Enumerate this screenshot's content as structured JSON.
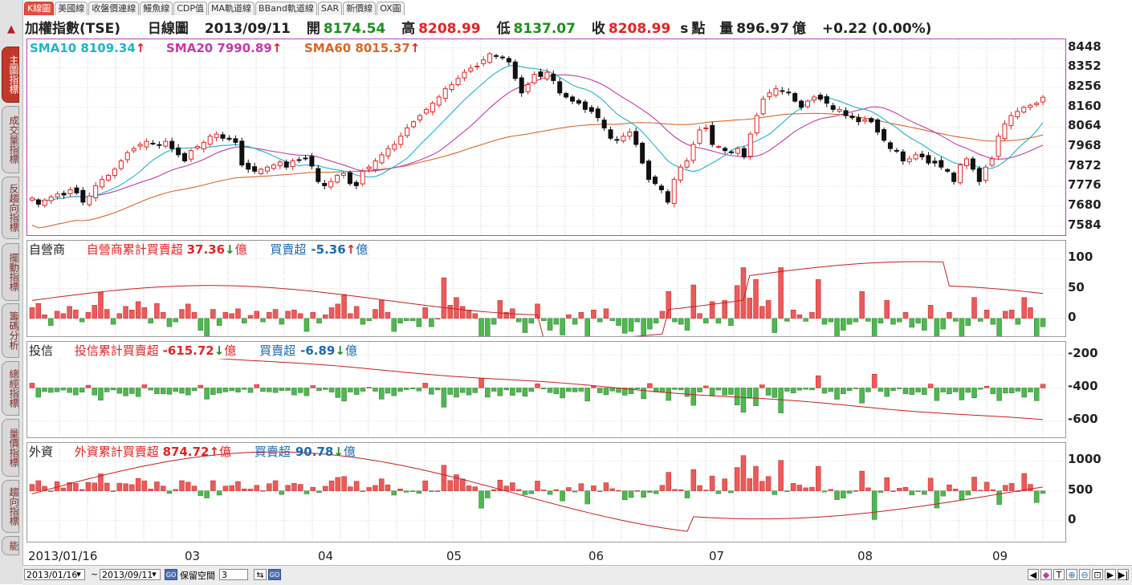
{
  "tabs": [
    "K線圖",
    "美國線",
    "收盤價連線",
    "鰻魚線",
    "CDP值",
    "MA軌道線",
    "BBand軌道線",
    "SAR",
    "新價線",
    "OX圖"
  ],
  "active_tab": 0,
  "side_tabs": [
    "主圖指標",
    "成交量指標",
    "反趨向指標",
    "擺動指標",
    "籌碼分析",
    "總經指標",
    "量價指標",
    "趨向指標",
    "能"
  ],
  "header": {
    "name": "加權指數(TSE)",
    "chart_type": "日線圖",
    "date": "2013/09/11",
    "open_label": "開",
    "open": "8174.54",
    "high_label": "高",
    "high": "8208.99",
    "low_label": "低",
    "low": "8137.07",
    "close_label": "收",
    "close": "8208.99",
    "s_label": "s",
    "points_label": "點",
    "vol_label": "量",
    "volume": "896.97",
    "vol_unit": "億",
    "change": "+0.22 (0.00%)"
  },
  "main": {
    "sma10": "SMA10 8109.34",
    "sma20": "SMA20 7990.89",
    "sma60": "SMA60 8015.37",
    "arrow_up": "↑",
    "yticks": [
      "8448",
      "8352",
      "8256",
      "8160",
      "8064",
      "7968",
      "7872",
      "7776",
      "7680",
      "7584"
    ]
  },
  "dealer": {
    "title": "自營商",
    "cum_label": "自營商累計買賣超",
    "cum": "37.36",
    "cum_arrow": "↓",
    "unit": "億",
    "net_label": "買賣超",
    "net": "-5.36",
    "net_arrow": "↑",
    "yticks": [
      "100",
      "50",
      "0"
    ]
  },
  "trust": {
    "title": "投信",
    "cum_label": "投信累計買賣超",
    "cum": "-615.72",
    "cum_arrow": "↓",
    "unit": "億",
    "net_label": "買賣超",
    "net": "-6.89",
    "net_arrow": "↓",
    "yticks": [
      "-200",
      "-400",
      "-600"
    ]
  },
  "foreign": {
    "title": "外資",
    "cum_label": "外資累計買賣超",
    "cum": "874.72",
    "cum_arrow": "↑",
    "unit": "億",
    "net_label": "買賣超",
    "net": "90.78",
    "net_arrow": "↓",
    "yticks": [
      "1000",
      "500",
      "0"
    ]
  },
  "date_axis": [
    "2013/01/16",
    "03",
    "04",
    "05",
    "06",
    "07",
    "08",
    "09"
  ],
  "bottom": {
    "from": "2013/01/16",
    "tilde": "~",
    "to": "2013/09/11",
    "keep": "保留空間",
    "keep_val": "3"
  },
  "colors": {
    "up": "#e52323",
    "down": "#1e8f1e",
    "sma10": "#1fb5c8",
    "sma20": "#c23aa8",
    "sma60": "#d8682a",
    "bar_up": "#ec5a5a",
    "bar_down": "#4fb84f"
  },
  "chart_data": {
    "type": "candlestick",
    "ylim": [
      7540,
      8490
    ],
    "close": [
      7720,
      7690,
      7710,
      7725,
      7740,
      7735,
      7760,
      7745,
      7700,
      7730,
      7780,
      7810,
      7830,
      7860,
      7900,
      7940,
      7960,
      7980,
      7995,
      7985,
      7975,
      7995,
      7960,
      7930,
      7900,
      7950,
      7970,
      7990,
      8020,
      8030,
      8010,
      8005,
      7990,
      7880,
      7860,
      7850,
      7860,
      7870,
      7880,
      7895,
      7870,
      7900,
      7905,
      7910,
      7875,
      7800,
      7780,
      7800,
      7830,
      7840,
      7790,
      7780,
      7850,
      7870,
      7900,
      7930,
      7960,
      7980,
      8020,
      8060,
      8090,
      8120,
      8150,
      8180,
      8210,
      8250,
      8270,
      8300,
      8330,
      8350,
      8360,
      8390,
      8420,
      8410,
      8400,
      8380,
      8300,
      8230,
      8270,
      8320,
      8310,
      8330,
      8290,
      8230,
      8210,
      8190,
      8180,
      8150,
      8140,
      8110,
      8060,
      8010,
      8000,
      8020,
      8040,
      7980,
      7890,
      7810,
      7790,
      7760,
      7700,
      7810,
      7870,
      7900,
      7980,
      8050,
      8060,
      7980,
      7970,
      7950,
      7940,
      7960,
      7920,
      8030,
      8120,
      8200,
      8230,
      8250,
      8240,
      8230,
      8190,
      8160,
      8190,
      8210,
      8200,
      8180,
      8150,
      8150,
      8120,
      8110,
      8090,
      8100,
      8090,
      8040,
      8000,
      7960,
      7950,
      7900,
      7910,
      7930,
      7920,
      7890,
      7890,
      7870,
      7850,
      7800,
      7880,
      7910,
      7860,
      7800,
      7870,
      7910,
      8020,
      8080,
      8120,
      8140,
      8160,
      8170,
      8180,
      8209
    ]
  },
  "dealer_data": [
    18,
    25,
    6,
    -12,
    12,
    8,
    20,
    14,
    -6,
    10,
    22,
    44,
    15,
    -10,
    8,
    20,
    14,
    28,
    18,
    -8,
    25,
    10,
    -14,
    -6,
    15,
    24,
    10,
    -20,
    -30,
    15,
    -12,
    10,
    8,
    16,
    -8,
    5,
    12,
    -6,
    10,
    15,
    -10,
    12,
    14,
    8,
    -22,
    10,
    -8,
    6,
    18,
    24,
    40,
    8,
    20,
    -10,
    -4,
    15,
    30,
    10,
    -22,
    -8,
    -4,
    -4,
    -14,
    18,
    -14,
    0,
    68,
    22,
    35,
    20,
    14,
    8,
    -55,
    -30,
    -10,
    30,
    10,
    16,
    -6,
    -24,
    -8,
    24,
    -4,
    -20,
    -10,
    -28,
    6,
    -10,
    10,
    -50,
    14,
    -6,
    16,
    -4,
    -12,
    -25,
    -22,
    -6,
    -28,
    -18,
    -8,
    12,
    45,
    -6,
    -10,
    -20,
    56,
    8,
    -8,
    28,
    -8,
    30,
    -12,
    55,
    85,
    34,
    65,
    20,
    30,
    -24,
    85,
    -5,
    14,
    6,
    -5,
    10,
    65,
    -10,
    -6,
    -38,
    -20,
    -10,
    -6,
    45,
    -5,
    -80,
    -8,
    30,
    -10,
    -6,
    10,
    -15,
    -8,
    -20,
    22,
    -48,
    -18,
    10,
    -5,
    -38,
    -12,
    35,
    -5,
    14,
    -10,
    -38,
    12,
    14,
    -10,
    35,
    18,
    -36,
    -14
  ]
}
